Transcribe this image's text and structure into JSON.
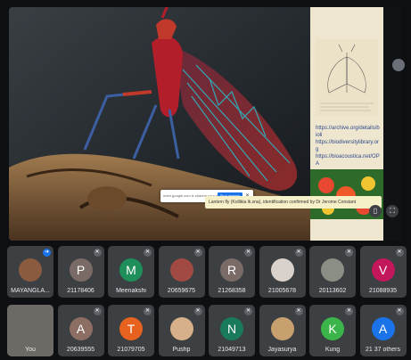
{
  "presentation": {
    "sidebar_links": [
      "https://archive.org/details/bioli",
      "https://biodiversitylibrary.org",
      "https://bioacoustica.net/OPA"
    ],
    "caption": "Lantern fly (Kollikia lk.sna), identification confirmed by Dr Jerome Constant",
    "popup_text": "meet.google.com is sharing your screen",
    "popup_button": "Stop sharing",
    "popup_close": "✕"
  },
  "participants": [
    {
      "name": "MAYANGLA...",
      "initial": "",
      "color": "#8a5b3f",
      "photo": true,
      "mic": "blue"
    },
    {
      "name": "21178406",
      "initial": "P",
      "color": "#7b6b66",
      "photo": false,
      "mic": "muted"
    },
    {
      "name": "Meenakshi",
      "initial": "M",
      "color": "#1e8e5a",
      "photo": false,
      "mic": "muted"
    },
    {
      "name": "20659675",
      "initial": "",
      "color": "#a04a43",
      "photo": true,
      "mic": "muted"
    },
    {
      "name": "21268358",
      "initial": "R",
      "color": "#7b6b66",
      "photo": false,
      "mic": "muted"
    },
    {
      "name": "21005678",
      "initial": "",
      "color": "#d9d2cc",
      "photo": true,
      "mic": "muted"
    },
    {
      "name": "20113602",
      "initial": "",
      "color": "#8a8f86",
      "photo": true,
      "mic": "muted"
    },
    {
      "name": "21088935",
      "initial": "V",
      "color": "#c2185b",
      "photo": false,
      "mic": "muted"
    },
    {
      "name": "You",
      "initial": "",
      "color": "#6d6a66",
      "photo": true,
      "mic": "none"
    },
    {
      "name": "20639555",
      "initial": "A",
      "color": "#8d6e63",
      "photo": false,
      "mic": "muted"
    },
    {
      "name": "21079705",
      "initial": "T",
      "color": "#e8621f",
      "photo": false,
      "mic": "muted"
    },
    {
      "name": "Pushp",
      "initial": "",
      "color": "#d6b08a",
      "photo": true,
      "mic": "muted"
    },
    {
      "name": "21049713",
      "initial": "N",
      "color": "#1a7a5e",
      "photo": false,
      "mic": "muted"
    },
    {
      "name": "Jayasurya",
      "initial": "",
      "color": "#c8a070",
      "photo": true,
      "mic": "muted"
    },
    {
      "name": "Kung",
      "initial": "K",
      "color": "#3bb54a",
      "photo": false,
      "mic": "muted"
    },
    {
      "name": "21 37 others",
      "initial": "A",
      "color": "#1a73e8",
      "photo": false,
      "mic": "muted"
    }
  ]
}
